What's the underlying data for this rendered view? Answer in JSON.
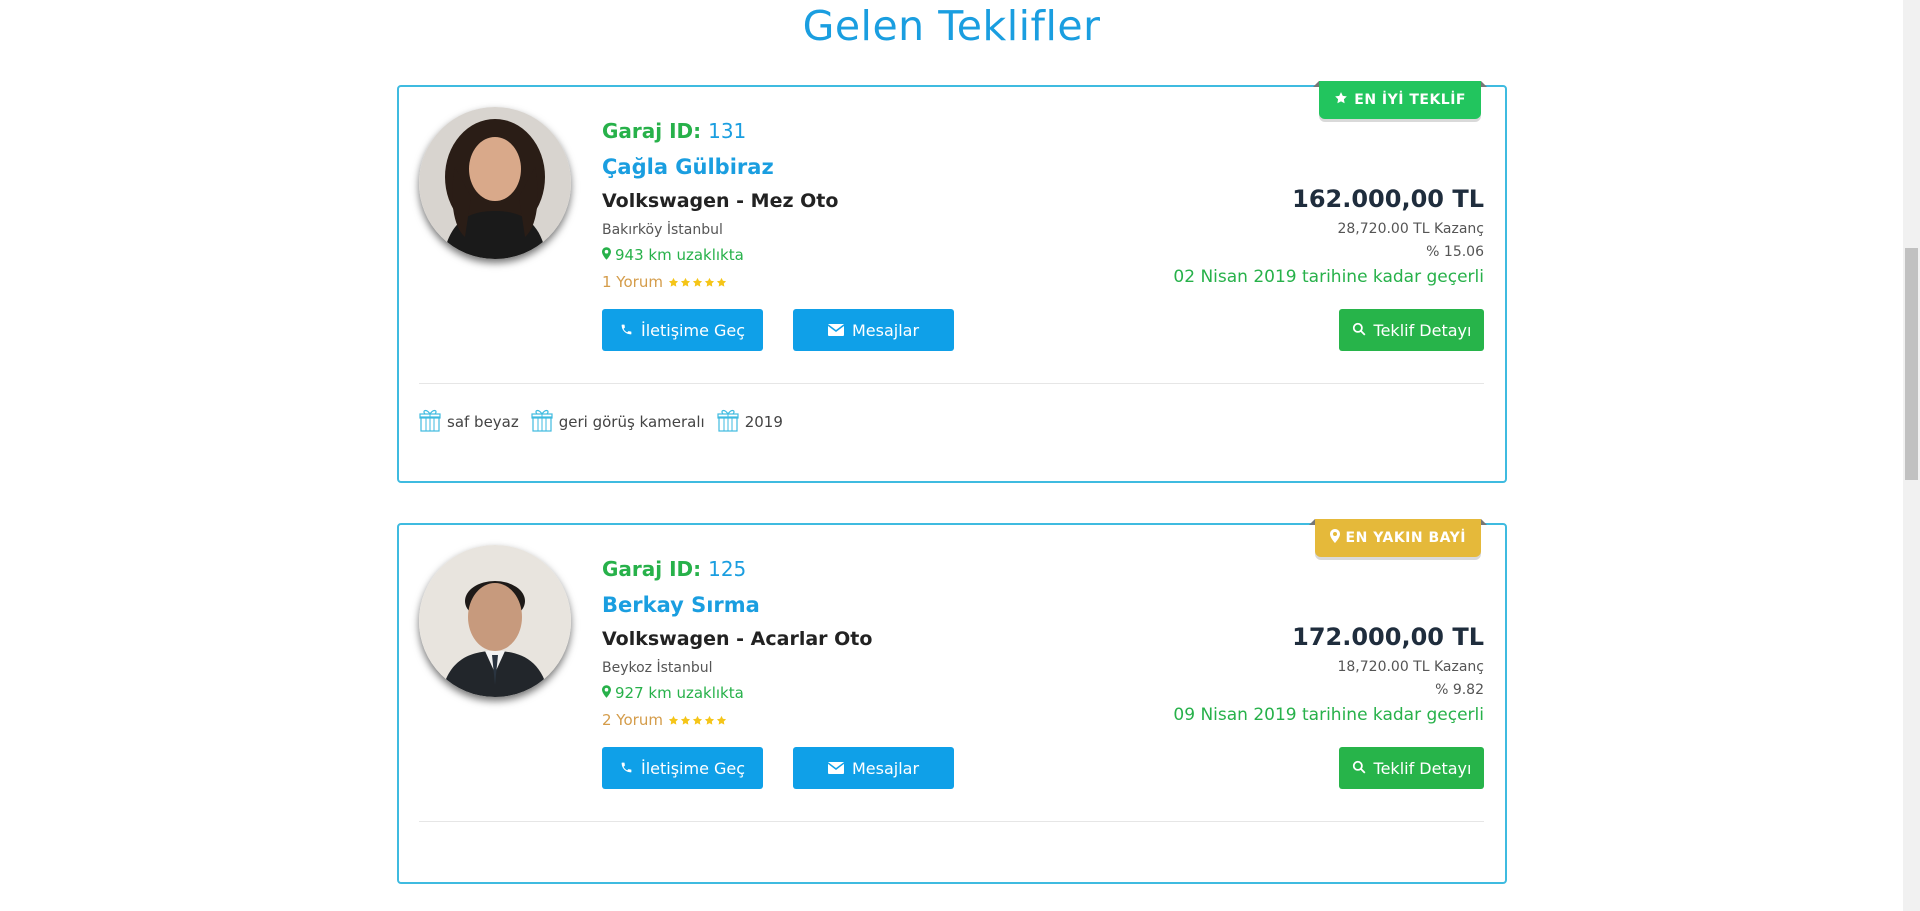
{
  "page": {
    "title": "Gelen Teklifler"
  },
  "colors": {
    "primary": "#1a9ee0",
    "green": "#27b14a",
    "badge_best": "#22c55e",
    "badge_near": "#e5b93a",
    "star": "#f5c518"
  },
  "offers": [
    {
      "badge": "EN İYİ TEKLİF",
      "badge_icon": "star-icon",
      "garage_label": "Garaj ID:",
      "garage_id": "131",
      "person_name": "Çağla Gülbiraz",
      "dealer": "Volkswagen - Mez Oto",
      "location": "Bakırköy İstanbul",
      "distance": "943 km uzaklıkta",
      "reviews": "1 Yorum",
      "rating": 5,
      "contact_button": "İletişime Geç",
      "messages_button": "Mesajlar",
      "price": "162.000,00 TL",
      "gain": "28,720.00 TL Kazanç",
      "percent": "% 15.06",
      "valid_until": "02 Nisan 2019 tarihine kadar geçerli",
      "detail_button": "Teklif Detayı",
      "features": [
        "saf beyaz",
        "geri görüş kameralı",
        "2019"
      ]
    },
    {
      "badge": "EN YAKIN BAYİ",
      "badge_icon": "map-marker-icon",
      "garage_label": "Garaj ID:",
      "garage_id": "125",
      "person_name": "Berkay Sırma",
      "dealer": "Volkswagen - Acarlar Oto",
      "location": "Beykoz İstanbul",
      "distance": "927 km uzaklıkta",
      "reviews": "2 Yorum",
      "rating": 5,
      "contact_button": "İletişime Geç",
      "messages_button": "Mesajlar",
      "price": "172.000,00 TL",
      "gain": "18,720.00 TL Kazanç",
      "percent": "% 9.82",
      "valid_until": "09 Nisan 2019 tarihine kadar geçerli",
      "detail_button": "Teklif Detayı",
      "features": []
    }
  ]
}
